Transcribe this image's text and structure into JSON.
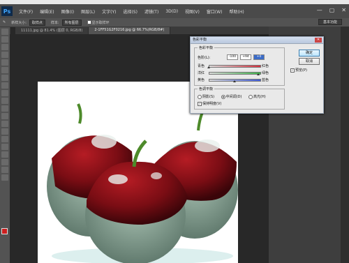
{
  "app": {
    "logo": "Ps"
  },
  "menubar": {
    "items": [
      {
        "label": "文件(F)"
      },
      {
        "label": "编辑(E)"
      },
      {
        "label": "图像(I)"
      },
      {
        "label": "图层(L)"
      },
      {
        "label": "文字(Y)"
      },
      {
        "label": "选择(S)"
      },
      {
        "label": "滤镜(T)"
      },
      {
        "label": "3D(D)"
      },
      {
        "label": "视图(V)"
      },
      {
        "label": "窗口(W)"
      },
      {
        "label": "帮助(H)"
      }
    ],
    "window_buttons": [
      "—",
      "▢",
      "✕"
    ]
  },
  "optionsbar": {
    "brush_size_label": "新样大小:",
    "brush_size_value": "取样点",
    "style_label": "样本:",
    "style_value": "所有图层",
    "show_ring": "显示取样环",
    "workspace": "基本功能"
  },
  "tabs": [
    {
      "label": "11111.jpg @ 81.4% (图层 0, RGB/8)"
    },
    {
      "label": "2-1FF51G2F0216.jpg @ 66.7%(RGB/8#)"
    }
  ],
  "dialog": {
    "title": "色彩平衡",
    "group1_legend": "色彩平衡",
    "levels_label": "色阶(L):",
    "levels": [
      "-100",
      "+94",
      "+0"
    ],
    "sliders": [
      {
        "left": "青色",
        "right": "红色",
        "value": -100,
        "track_color": "#d9303e"
      },
      {
        "left": "洋红",
        "right": "绿色",
        "value": 94,
        "track_color": "#3db54a"
      },
      {
        "left": "黄色",
        "right": "蓝色",
        "value": 0,
        "track_color": "#3e5bd8"
      }
    ],
    "group2_legend": "色调平衡",
    "tone_options": [
      "阴影(S)",
      "中间调(D)",
      "高光(H)"
    ],
    "tone_selected": "中间调(D)",
    "preserve_luminosity": "保持明度(V)",
    "preserve_checked": true,
    "ok_label": "确定",
    "cancel_label": "取消",
    "preview_label": "预览(P)",
    "preview_checked": true
  },
  "colors": {
    "foreground": "#cc1f1f",
    "background": "#ffffff"
  }
}
